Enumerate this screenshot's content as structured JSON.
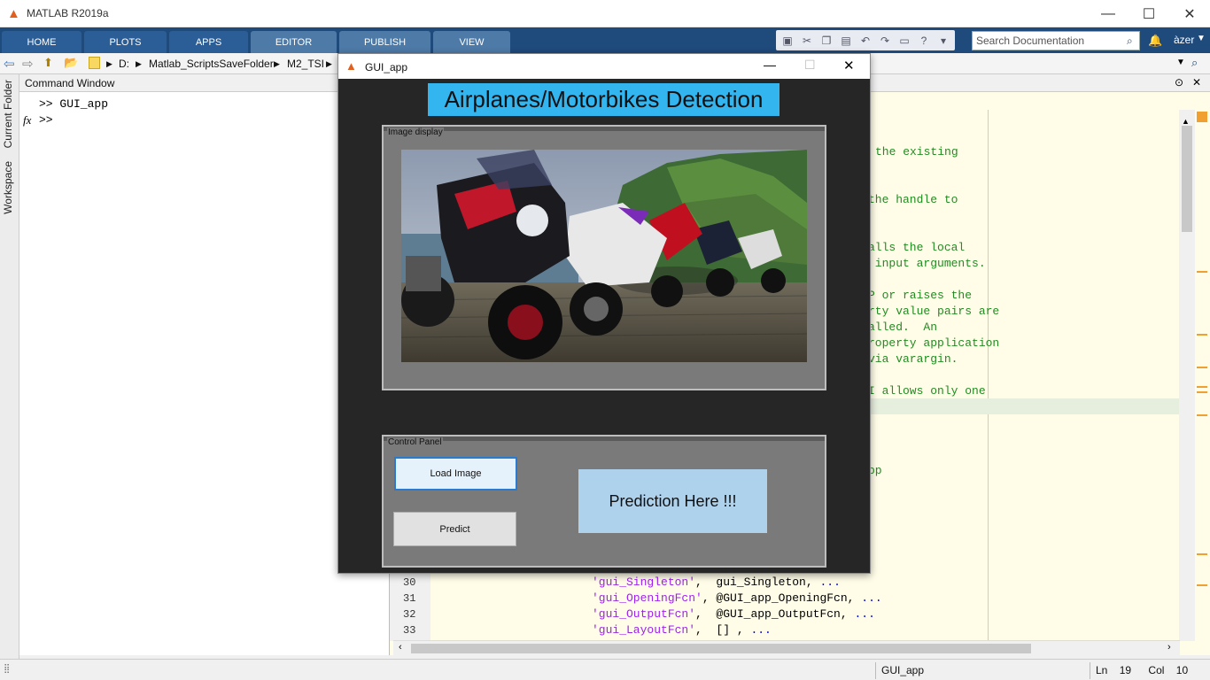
{
  "app": {
    "title": "MATLAB R2019a"
  },
  "ribbon": {
    "tabs": [
      "HOME",
      "PLOTS",
      "APPS",
      "EDITOR",
      "PUBLISH",
      "VIEW"
    ],
    "search_placeholder": "Search Documentation",
    "user": "àzer"
  },
  "address": {
    "path": [
      "D:",
      "Matlab_ScriptsSaveFolder",
      "M2_TSI"
    ]
  },
  "side_tabs": [
    "Current Folder",
    "Workspace"
  ],
  "command_window": {
    "title": "Command Window",
    "lines": [
      ">> GUI_app",
      ">>"
    ],
    "fx": "fx"
  },
  "editor": {
    "partial_lines": [
      "the existing",
      "the handle to",
      "alls the local",
      " input arguments.",
      "P or raises the",
      "rty value pairs are",
      "alled.  An",
      "roperty application",
      "via varargin.",
      "I allows only one",
      "pp"
    ],
    "code_lines": [
      {
        "num": "30",
        "str": "'gui_Singleton'",
        "rest": ",  gui_Singleton, ",
        "dots": "..."
      },
      {
        "num": "31",
        "str": "'gui_OpeningFcn'",
        "rest": ", @GUI_app_OpeningFcn, ",
        "dots": "..."
      },
      {
        "num": "32",
        "str": "'gui_OutputFcn'",
        "rest": ",  @GUI_app_OutputFcn, ",
        "dots": "..."
      },
      {
        "num": "33",
        "str": "'gui_LayoutFcn'",
        "rest": ",  [] , ",
        "dots": "..."
      }
    ]
  },
  "status": {
    "file": "GUI_app",
    "ln_label": "Ln",
    "ln": "19",
    "col_label": "Col",
    "col": "10"
  },
  "gui": {
    "window_title": "GUI_app",
    "heading": "Airplanes/Motorbikes Detection",
    "image_panel_title": "Image display",
    "control_panel_title": "Control Panel",
    "load_button": "Load Image",
    "predict_button": "Predict",
    "prediction_text": "Prediction Here !!!",
    "photo_subject": "motorbikes parked on cobblestone road by the sea"
  }
}
